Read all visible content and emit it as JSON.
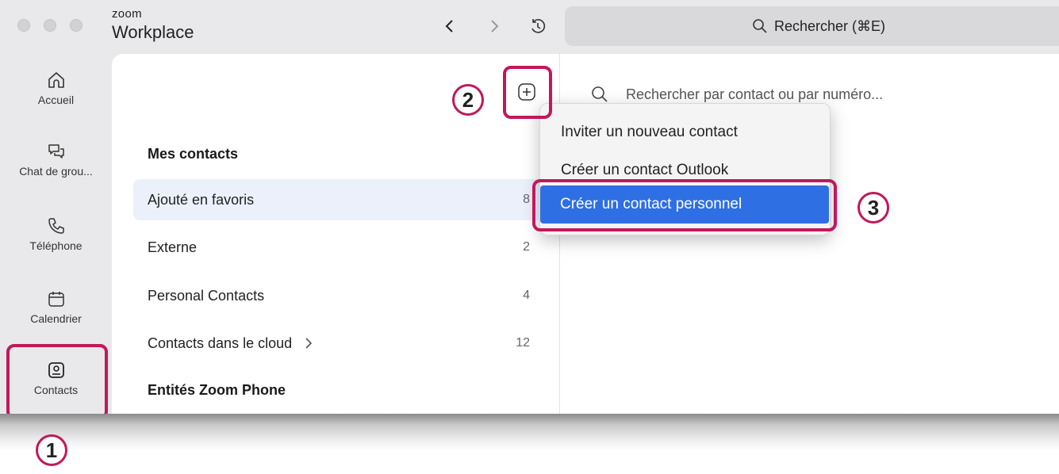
{
  "app": {
    "brand_small": "zoom",
    "brand_large": "Workplace"
  },
  "search": {
    "label": "Rechercher (⌘E)"
  },
  "sidebar": {
    "items": [
      {
        "label": "Accueil",
        "icon": "home-icon"
      },
      {
        "label": "Chat de grou...",
        "icon": "chat-icon"
      },
      {
        "label": "Téléphone",
        "icon": "phone-icon"
      },
      {
        "label": "Calendrier",
        "icon": "calendar-icon"
      },
      {
        "label": "Contacts",
        "icon": "contacts-icon"
      }
    ]
  },
  "contacts": {
    "section1": "Mes contacts",
    "rows": [
      {
        "label": "Ajouté en favoris",
        "count": "8"
      },
      {
        "label": "Externe",
        "count": "2"
      },
      {
        "label": "Personal Contacts",
        "count": "4"
      },
      {
        "label": "Contacts dans le cloud",
        "count": "12"
      }
    ],
    "section2": "Entités Zoom Phone"
  },
  "right_search": {
    "placeholder": "Rechercher par contact ou par numéro..."
  },
  "menu": {
    "items": [
      "Inviter un nouveau contact",
      "Créer un contact Outlook",
      "Créer un contact personnel"
    ]
  },
  "annotations": {
    "step1": "1",
    "step2": "2",
    "step3": "3"
  },
  "colors": {
    "highlight": "#c2185b",
    "selection": "#2f6fe4",
    "active_row": "#ebf0fb"
  }
}
